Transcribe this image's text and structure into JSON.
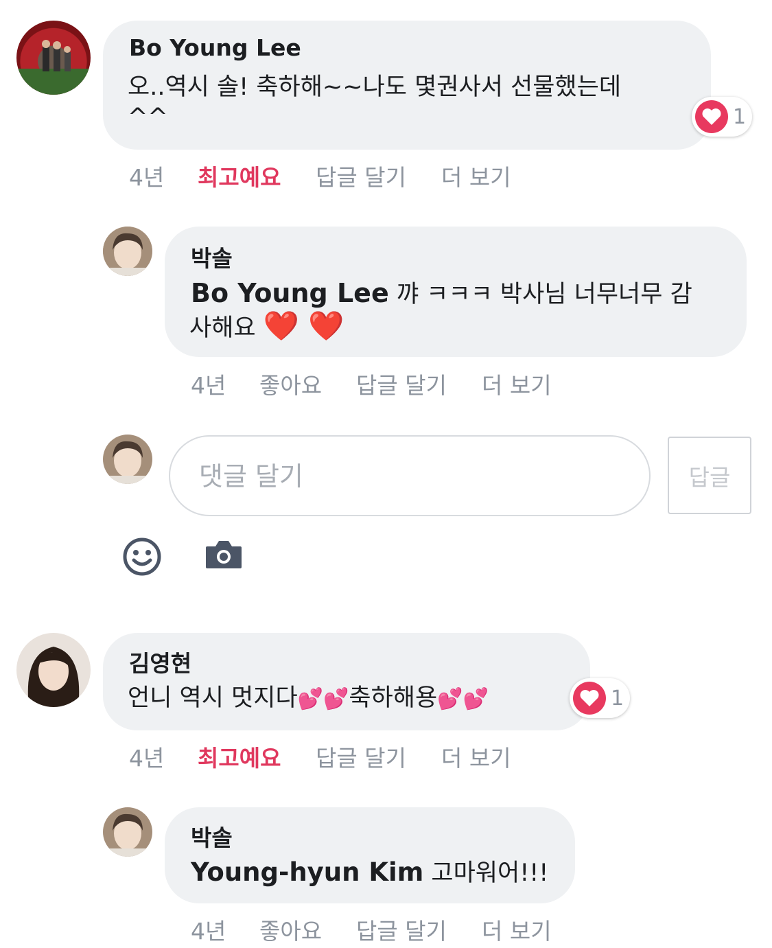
{
  "colors": {
    "bubble": "#eff1f3",
    "love": "#e0385e",
    "meta": "#8d949e",
    "icon": "#4b5566"
  },
  "comments": [
    {
      "author": "Bo Young Lee",
      "text_line1": "오..역시 솔! 축하해~~나도 몇권사서 선물했는데",
      "text_line2": "^^",
      "reaction_count": "1",
      "time": "4년",
      "like": "최고예요",
      "reply": "답글 달기",
      "more": "더 보기"
    },
    {
      "author": "박솔",
      "mention": "Bo Young Lee",
      "text_line1": " 꺄 ㅋㅋㅋ 박사님 너무너무 감",
      "text_line2": "사해요 ",
      "emoji": "❤️ ❤️",
      "time": "4년",
      "like": "좋아요",
      "reply": "답글 달기",
      "more": "더 보기"
    },
    {
      "author": "김영현",
      "text_part1": "언니 역시 멋지다",
      "emoji1": "💕💕",
      "text_part2": "축하해용",
      "emoji2": "💕💕",
      "reaction_count": "1",
      "time": "4년",
      "like": "최고예요",
      "reply": "답글 달기",
      "more": "더 보기"
    },
    {
      "author": "박솔",
      "mention": "Young-hyun Kim",
      "text": " 고마워어!!!",
      "time": "4년",
      "like": "좋아요",
      "reply": "답글 달기",
      "more": "더 보기"
    }
  ],
  "reply_input": {
    "placeholder": "댓글 달기",
    "value": "",
    "submit_label": "답글"
  },
  "icons": {
    "emoji": "smiley-icon",
    "camera": "camera-icon",
    "reaction": "heart-icon"
  }
}
